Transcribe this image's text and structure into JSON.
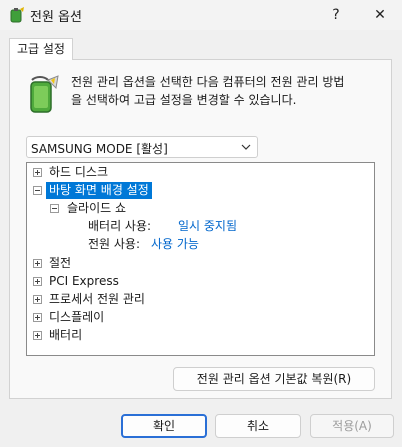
{
  "window": {
    "title": "전원 옵션",
    "help_label": "?",
    "close_label": "✕"
  },
  "tabs": [
    {
      "label": "고급 설정",
      "selected": true
    }
  ],
  "description": {
    "line1": "전원 관리 옵션을 선택한 다음 컴퓨터의 전원 관리 방법",
    "line2": "을 선택하여 고급 설정을 변경할 수 있습니다."
  },
  "plan_select": {
    "value": "SAMSUNG MODE [활성]"
  },
  "tree": {
    "hard_disk": "하드 디스크",
    "desktop_background": "바탕 화면 배경 설정",
    "slideshow": "슬라이드 쇼",
    "on_battery_label": "배터리 사용:",
    "on_battery_value": "일시 중지됨",
    "plugged_in_label": "전원 사용:",
    "plugged_in_value": "사용 가능",
    "sleep": "절전",
    "pci_express": "PCI Express",
    "processor": "프로세서 전원 관리",
    "display": "디스플레이",
    "battery": "배터리"
  },
  "buttons": {
    "restore": "전원 관리 옵션 기본값 복원(R)",
    "ok": "확인",
    "cancel": "취소",
    "apply": "적용(A)"
  },
  "colors": {
    "selection": "#0078d7",
    "link": "#0066cc",
    "primary_border": "#2a6fd6"
  }
}
